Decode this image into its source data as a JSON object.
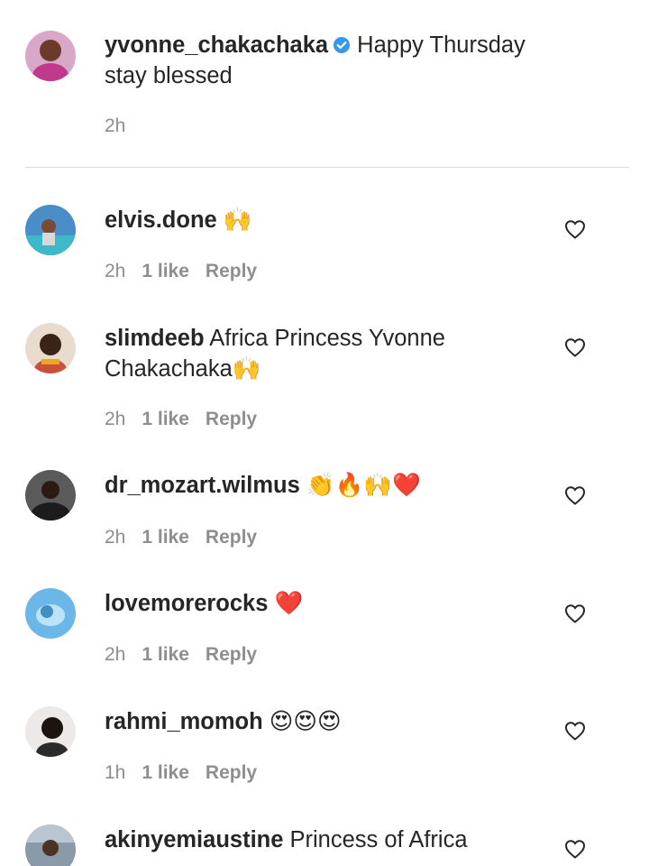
{
  "caption": {
    "username": "yvonne_chakachaka",
    "verified_icon": "verified-badge-icon",
    "text": "Happy Thursday stay blessed",
    "time": "2h"
  },
  "comments": [
    {
      "username": "elvis.done",
      "text": "🙌",
      "time": "2h",
      "likes": "1 like",
      "reply": "Reply",
      "avatar_color": "#4a8ec9"
    },
    {
      "username": "slimdeeb",
      "text": "Africa Princess Yvonne Chakachaka🙌",
      "time": "2h",
      "likes": "1 like",
      "reply": "Reply",
      "avatar_color": "#c9503b"
    },
    {
      "username": "dr_mozart.wilmus",
      "text": "👏🔥🙌❤️",
      "time": "2h",
      "likes": "1 like",
      "reply": "Reply",
      "avatar_color": "#3b3b3b"
    },
    {
      "username": "lovemorerocks",
      "text": "❤️",
      "time": "2h",
      "likes": "1 like",
      "reply": "Reply",
      "avatar_color": "#6bb8e8"
    },
    {
      "username": "rahmi_momoh",
      "text": "😍😍😍",
      "time": "1h",
      "likes": "1 like",
      "reply": "Reply",
      "avatar_color": "#2b2b2b"
    },
    {
      "username": "akinyemiaustine",
      "text": "Princess of Africa",
      "avatar_color": "#8a9aa8"
    }
  ],
  "colors": {
    "text": "#262626",
    "meta": "#8e8e8e",
    "verified": "#3897f0",
    "divider": "#dbdbdb"
  }
}
